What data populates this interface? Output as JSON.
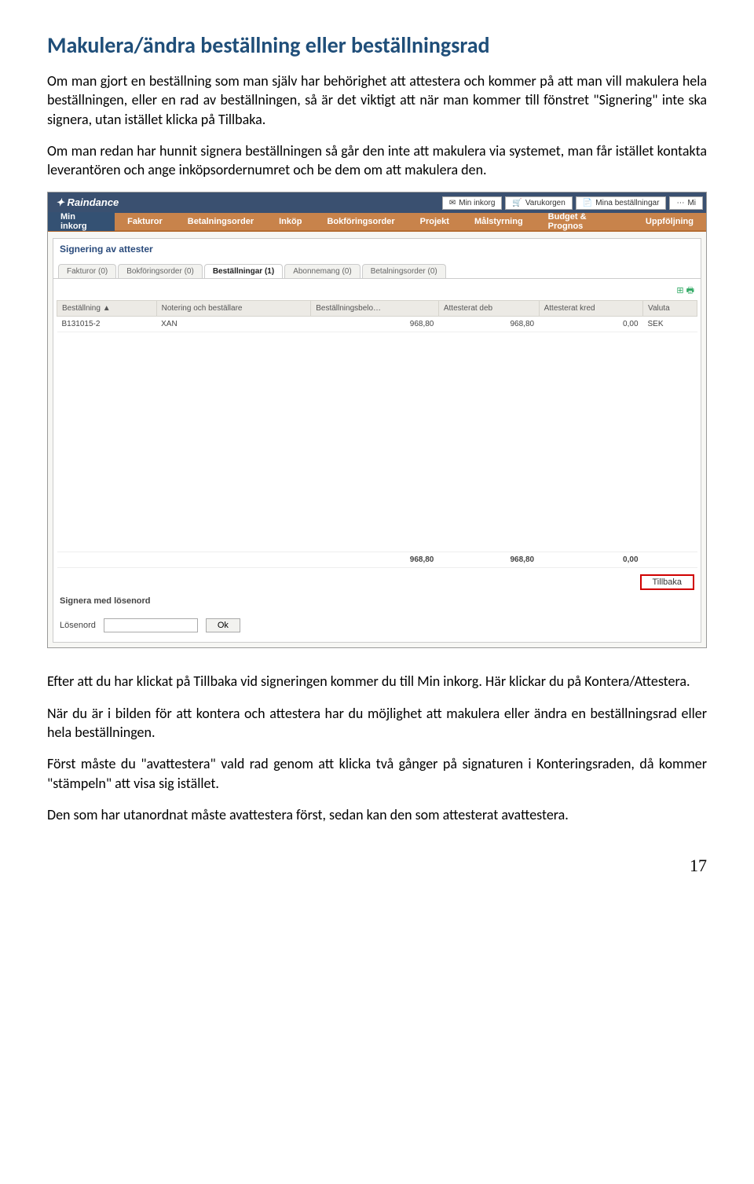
{
  "heading": "Makulera/ändra beställning eller beställningsrad",
  "para1": "Om man gjort en beställning som man själv har behörighet att attestera och kommer på att man vill makulera hela beställningen, eller en rad av beställningen, så är det viktigt att när man kommer till fönstret \"Signering\" inte ska signera, utan istället klicka på Tillbaka.",
  "para2": "Om man redan har hunnit signera beställningen så går den inte att makulera via systemet, man får istället kontakta leverantören och ange inköpsordernumret och be dem om att makulera den.",
  "para3": "Efter att du har klickat på Tillbaka vid signeringen kommer du till Min inkorg. Här klickar du på Kontera/Attestera.",
  "para4": "När du är i bilden för att kontera och attestera har du möjlighet att makulera eller ändra en beställningsrad eller hela beställningen.",
  "para5": "Först måste du \"avattestera\" vald rad genom att klicka två gånger på signaturen i Konteringsraden, då kommer \"stämpeln\" att visa sig istället.",
  "para6": "Den som har utanordnat måste avattestera först, sedan kan den som attesterat avattestera.",
  "pageNumber": "17",
  "app": {
    "logo": "Raindance",
    "topButtons": {
      "inbox": "Min inkorg",
      "cart": "Varukorgen",
      "orders": "Mina beställningar",
      "more": "Mi"
    },
    "nav": {
      "item0": "Min inkorg",
      "item1": "Fakturor",
      "item2": "Betalningsorder",
      "item3": "Inköp",
      "item4": "Bokföringsorder",
      "item5": "Projekt",
      "item6": "Målstyrning",
      "item7": "Budget & Prognos",
      "item8": "Uppföljning"
    },
    "panelTitle": "Signering av attester",
    "tabs": {
      "t0": "Fakturor (0)",
      "t1": "Bokföringsorder (0)",
      "t2": "Beställningar (1)",
      "t3": "Abonnemang (0)",
      "t4": "Betalningsorder (0)"
    },
    "columns": {
      "c0": "Beställning ▲",
      "c1": "Notering och beställare",
      "c2": "Beställningsbelo…",
      "c3": "Attesterat deb",
      "c4": "Attesterat kred",
      "c5": "Valuta"
    },
    "row": {
      "order": "B131015-2",
      "note": "XAN",
      "amount": "968,80",
      "deb": "968,80",
      "kred": "0,00",
      "valuta": "SEK"
    },
    "totals": {
      "amount": "968,80",
      "deb": "968,80",
      "kred": "0,00"
    },
    "tillbaka": "Tillbaka",
    "signLabel": "Signera med lösenord",
    "pwLabel": "Lösenord",
    "ok": "Ok"
  }
}
